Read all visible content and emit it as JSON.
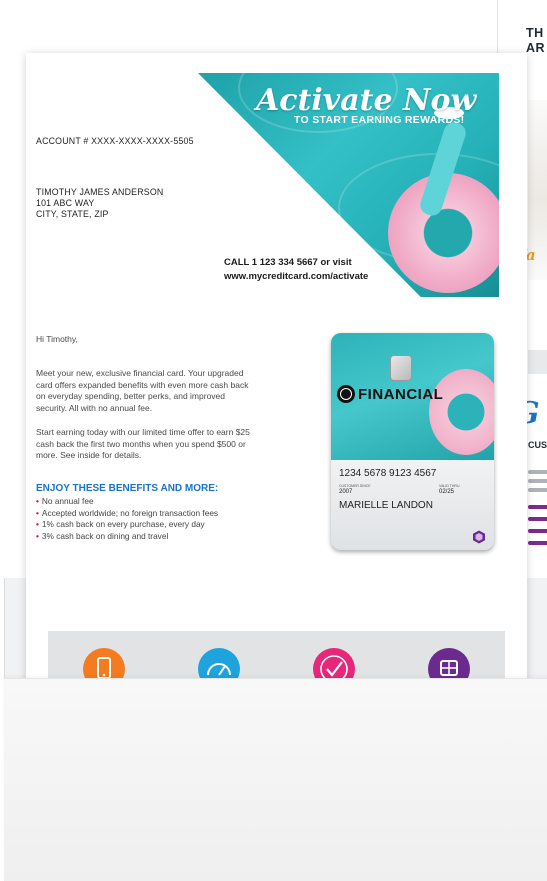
{
  "back_page": {
    "title": "TH\nAR",
    "script_a": "Fa",
    "script_b": "G",
    "subheading": "CUS"
  },
  "letter": {
    "hero": {
      "title": "Activate Now",
      "subtitle": "TO START EARNING REWARDS!"
    },
    "account": "ACCOUNT # XXXX-XXXX-XXXX-5505",
    "address": {
      "name": "TIMOTHY JAMES ANDERSON",
      "line1": "101 ABC WAY",
      "line2": "CITY, STATE, ZIP"
    },
    "call_to_action": {
      "line1": "CALL 1 123 334 5667 or visit",
      "url": "www.mycreditcard.com/activate"
    },
    "greeting": "Hi Timothy,",
    "paragraph_1": "Meet your new, exclusive financial card. Your upgraded card offers expanded benefits with even more cash back on everyday spending, better perks, and improved security. All with no annual fee.",
    "paragraph_2": "Start earning today with our limited time offer to earn $25 cash back the first two months when you spend $500 or more. See inside for details.",
    "benefits_heading": "ENJOY THESE BENEFITS AND MORE:",
    "benefits": [
      "No annual fee",
      "Accepted worldwide; no foreign transaction fees",
      "1% cash back on every purchase, every day",
      "3% cash back on dining and travel"
    ],
    "bullet": "•",
    "card": {
      "brand": "FINANCIAL",
      "number": "1234 5678 9123 4567",
      "since_label": "CUSTOMER SINCE",
      "since_value": "2007",
      "expiry_label": "VALID THRU",
      "expiry_value": "02/25",
      "holder": "MARIELLE LANDON"
    },
    "icons": [
      {
        "name": "mobile-phone-icon",
        "color": "#f47b20"
      },
      {
        "name": "speedometer-icon",
        "color": "#1ea3dd"
      },
      {
        "name": "checkmark-icon",
        "color": "#e6287a"
      },
      {
        "name": "card-chip-icon",
        "color": "#6b2a8f"
      }
    ]
  }
}
